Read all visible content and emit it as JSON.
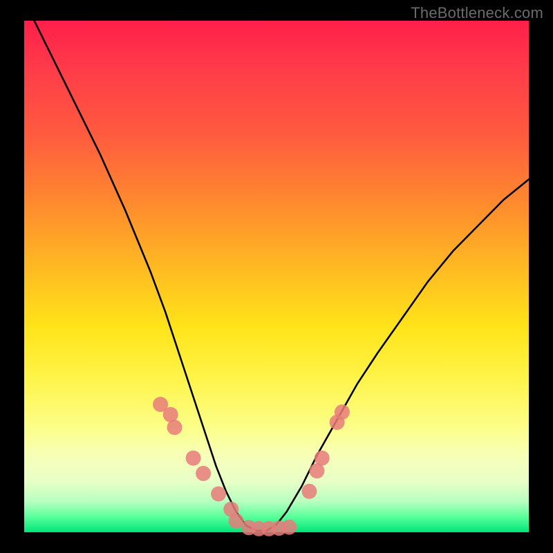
{
  "watermark": "TheBottleneck.com",
  "chart_data": {
    "type": "line",
    "title": "",
    "xlabel": "",
    "ylabel": "",
    "xlim": [
      0,
      100
    ],
    "ylim": [
      0,
      100
    ],
    "series": [
      {
        "name": "bottleneck-curve",
        "x": [
          0,
          5,
          10,
          15,
          20,
          25,
          28,
          30,
          32,
          34,
          36,
          38,
          40,
          42,
          44,
          46,
          48,
          50,
          52,
          55,
          58,
          62,
          66,
          70,
          75,
          80,
          85,
          90,
          95,
          100
        ],
        "y": [
          104,
          94,
          84,
          74,
          63,
          51,
          43,
          37,
          31,
          25,
          19,
          13,
          8,
          4,
          1.3,
          0.3,
          0.3,
          1.5,
          4,
          9,
          15,
          22,
          29,
          35,
          42,
          49,
          55,
          60,
          65,
          69
        ]
      }
    ],
    "markers": {
      "name": "highlight-dots",
      "points": [
        {
          "x": 27.0,
          "y": 25.0
        },
        {
          "x": 29.0,
          "y": 23.0
        },
        {
          "x": 29.8,
          "y": 20.5
        },
        {
          "x": 33.5,
          "y": 14.5
        },
        {
          "x": 35.5,
          "y": 11.5
        },
        {
          "x": 38.5,
          "y": 7.5
        },
        {
          "x": 41.0,
          "y": 4.5
        },
        {
          "x": 42.0,
          "y": 2.2
        },
        {
          "x": 44.5,
          "y": 0.9
        },
        {
          "x": 46.5,
          "y": 0.7
        },
        {
          "x": 48.5,
          "y": 0.7
        },
        {
          "x": 50.5,
          "y": 0.8
        },
        {
          "x": 52.5,
          "y": 1.0
        },
        {
          "x": 56.5,
          "y": 8.0
        },
        {
          "x": 58.0,
          "y": 12.0
        },
        {
          "x": 59.0,
          "y": 14.5
        },
        {
          "x": 62.0,
          "y": 21.5
        },
        {
          "x": 63.0,
          "y": 23.5
        }
      ]
    }
  }
}
